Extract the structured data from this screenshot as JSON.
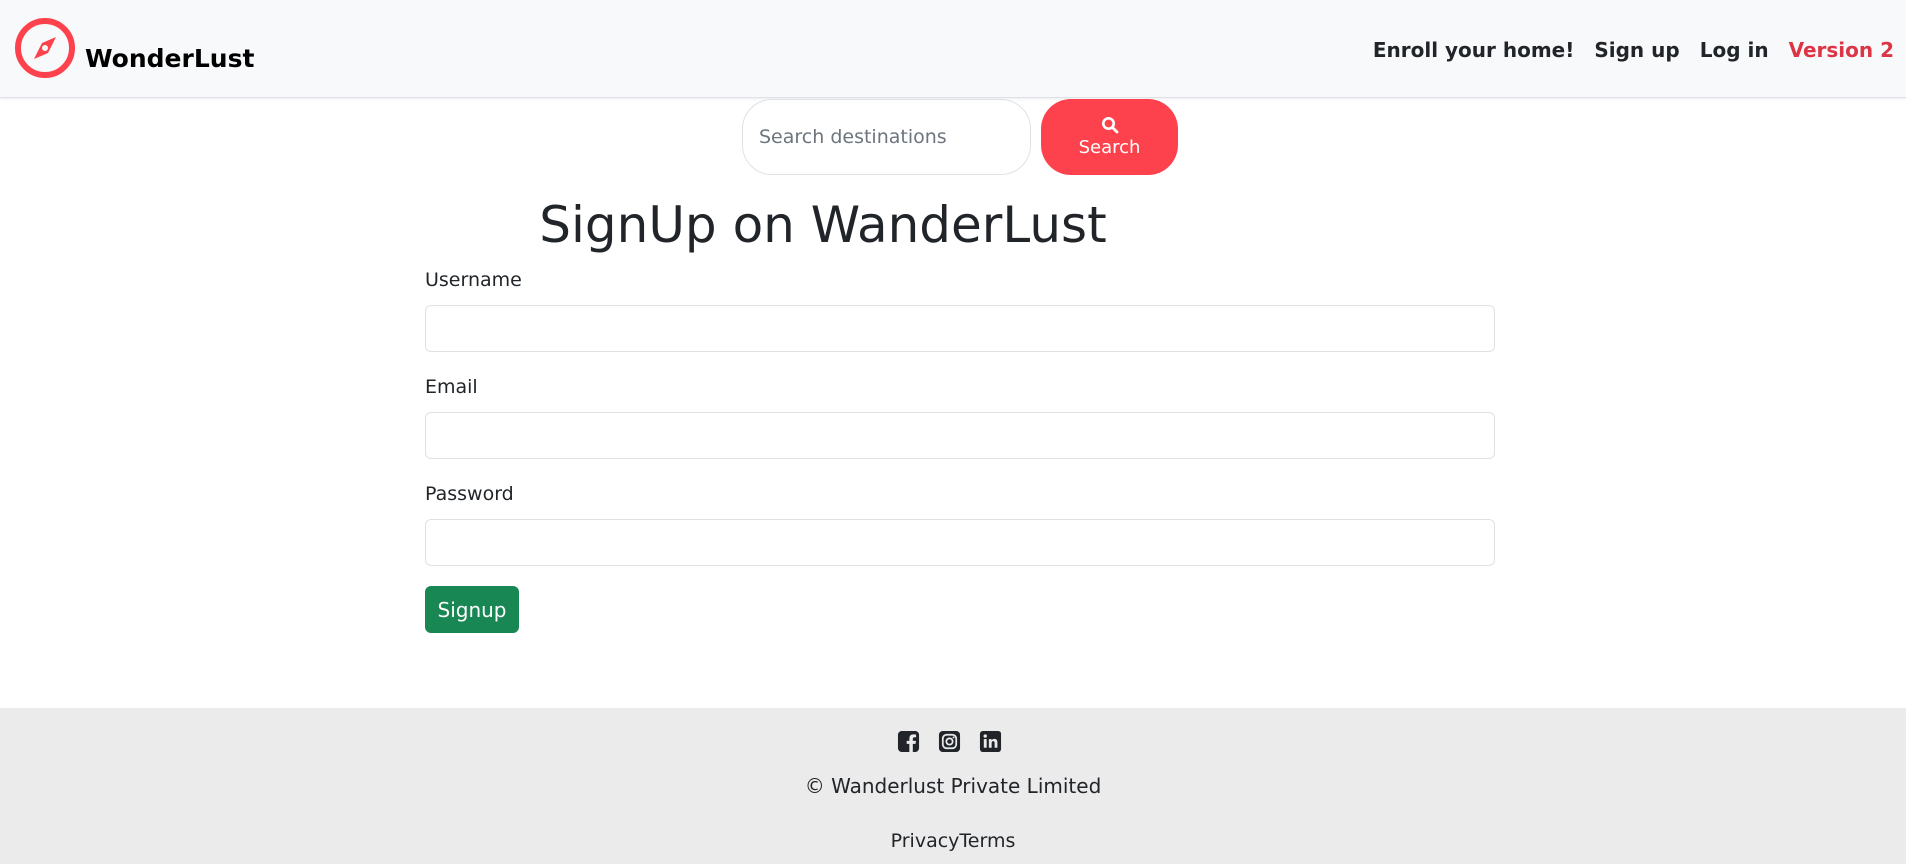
{
  "brand": {
    "name": "WonderLust",
    "icon": "compass-icon",
    "color": "#fe424d"
  },
  "nav": {
    "links": [
      {
        "label": "Enroll your home!"
      },
      {
        "label": "Sign up"
      },
      {
        "label": "Log in"
      },
      {
        "label": "Version 2",
        "color": "#dc3545"
      }
    ]
  },
  "search": {
    "placeholder": "Search destinations",
    "value": "",
    "button_label": "Search",
    "button_icon": "search-icon",
    "button_color": "#fe424d"
  },
  "form": {
    "title": "SignUp on WanderLust",
    "fields": [
      {
        "label": "Username",
        "value": ""
      },
      {
        "label": "Email",
        "value": ""
      },
      {
        "label": "Password",
        "value": ""
      }
    ],
    "submit_label": "Signup",
    "submit_color": "#198754"
  },
  "footer": {
    "social_icons": [
      "facebook-icon",
      "instagram-icon",
      "linkedin-icon"
    ],
    "copyright": "© Wanderlust Private Limited",
    "links": [
      "Privacy",
      "Terms"
    ]
  }
}
